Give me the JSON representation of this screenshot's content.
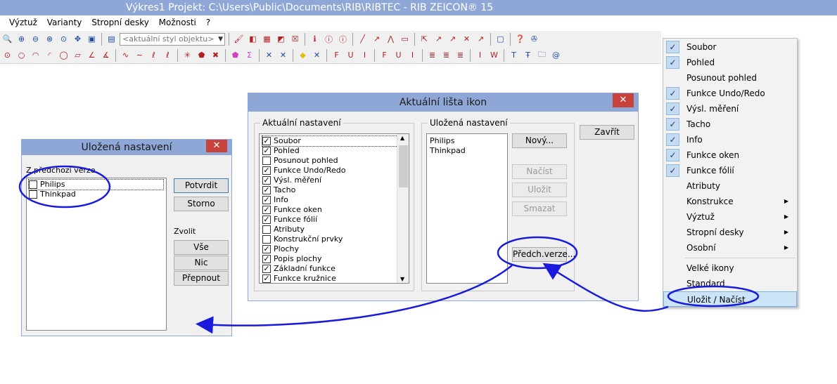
{
  "window": {
    "title": "Výkres1  Projekt: C:\\Users\\Public\\Documents\\RIB\\RIBTEC  -  RIB ZEICON® 15"
  },
  "menu": [
    "Výztuž",
    "Varianty",
    "Stropní desky",
    "Možnosti",
    "?"
  ],
  "toolbar": {
    "style_placeholder": "<aktuální styl objektu>"
  },
  "dialog_main": {
    "title": "Aktuální lišta ikon",
    "current_group": "Aktuální nastavení",
    "saved_group": "Uložená nastavení",
    "current_items": [
      {
        "label": "Soubor",
        "checked": true
      },
      {
        "label": "Pohled",
        "checked": true
      },
      {
        "label": "Posunout pohled",
        "checked": false
      },
      {
        "label": "Funkce Undo/Redo",
        "checked": true
      },
      {
        "label": "Výsl. měření",
        "checked": true
      },
      {
        "label": "Tacho",
        "checked": true
      },
      {
        "label": "Info",
        "checked": true
      },
      {
        "label": "Funkce oken",
        "checked": true
      },
      {
        "label": "Funkce fólií",
        "checked": true
      },
      {
        "label": "Atributy",
        "checked": false
      },
      {
        "label": "Konstrukční prvky",
        "checked": false
      },
      {
        "label": "Plochy",
        "checked": true
      },
      {
        "label": "Popis plochy",
        "checked": true
      },
      {
        "label": "Základní funkce",
        "checked": true
      },
      {
        "label": "Funkce kružnice",
        "checked": true
      }
    ],
    "saved_items": [
      "Philips",
      "Thinkpad"
    ],
    "buttons": {
      "close": "Zavřít",
      "new": "Nový...",
      "load": "Načíst",
      "save": "Uložit",
      "delete": "Smazat",
      "prev": "Předch.verze..."
    }
  },
  "dialog_saved": {
    "title": "Uložená nastavení",
    "list_label": "Z předchozí verze",
    "items": [
      "Philips",
      "Thinkpad"
    ],
    "confirm": "Potvrdit",
    "cancel": "Storno",
    "select_label": "Zvolit",
    "all": "Vše",
    "none": "Nic",
    "toggle": "Přepnout"
  },
  "context_menu": [
    {
      "label": "Soubor",
      "checked": true
    },
    {
      "label": "Pohled",
      "checked": true
    },
    {
      "label": "Posunout pohled",
      "checked": false
    },
    {
      "label": "Funkce Undo/Redo",
      "checked": true
    },
    {
      "label": "Výsl. měření",
      "checked": true
    },
    {
      "label": "Tacho",
      "checked": true
    },
    {
      "label": "Info",
      "checked": true
    },
    {
      "label": "Funkce oken",
      "checked": true
    },
    {
      "label": "Funkce fólií",
      "checked": true
    },
    {
      "label": "Atributy",
      "checked": false
    },
    {
      "label": "Konstrukce",
      "checked": false,
      "submenu": true
    },
    {
      "label": "Výztuž",
      "checked": false,
      "submenu": true
    },
    {
      "label": "Stropní desky",
      "checked": false,
      "submenu": true
    },
    {
      "label": "Osobní",
      "checked": false,
      "submenu": true
    },
    {
      "label": "Velké ikony",
      "checked": false
    },
    {
      "label": "Standard",
      "checked": false
    },
    {
      "label": "Uložit / Načíst",
      "checked": false,
      "highlighted": true
    }
  ],
  "colors": {
    "titlebar": "#8fa7d6",
    "annotation": "#1a1adc",
    "close": "#c7423b",
    "highlight": "#cce4f7"
  }
}
